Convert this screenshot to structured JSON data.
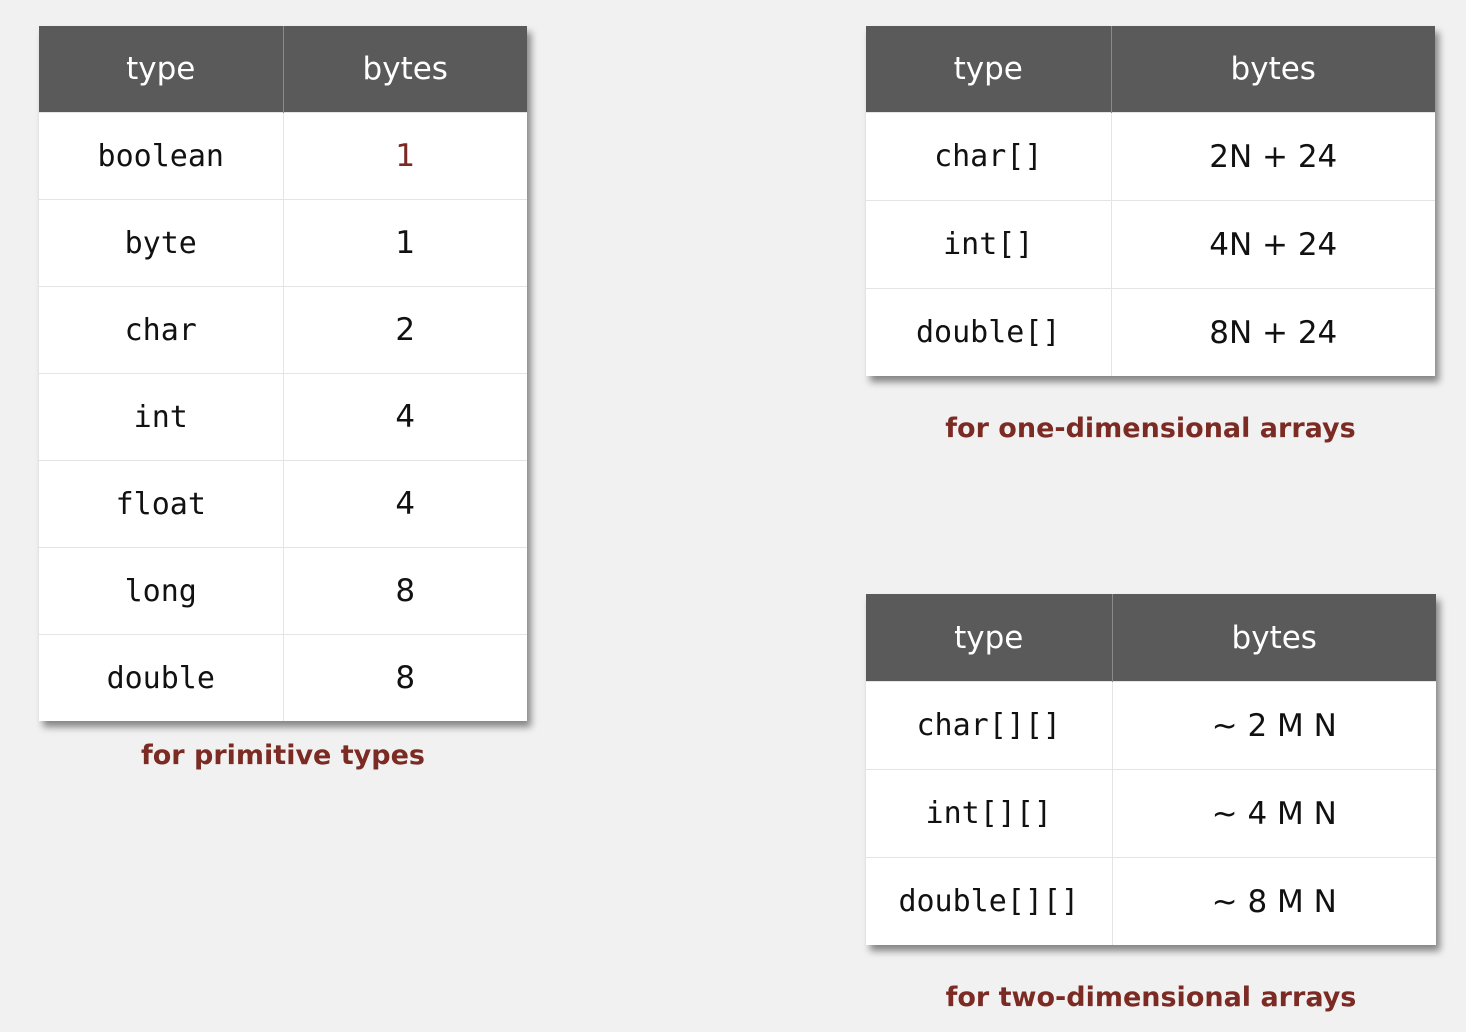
{
  "primitive": {
    "headers": [
      "type",
      "bytes"
    ],
    "rows": [
      {
        "type": "boolean",
        "bytes": "1"
      },
      {
        "type": "byte",
        "bytes": "1"
      },
      {
        "type": "char",
        "bytes": "2"
      },
      {
        "type": "int",
        "bytes": "4"
      },
      {
        "type": "float",
        "bytes": "4"
      },
      {
        "type": "long",
        "bytes": "8"
      },
      {
        "type": "double",
        "bytes": "8"
      }
    ],
    "caption": "for primitive types",
    "highlight_color": "#7a2a22"
  },
  "one_dim": {
    "headers": [
      "type",
      "bytes"
    ],
    "rows": [
      {
        "type": "char[]",
        "bytes": "2N + 24"
      },
      {
        "type": "int[]",
        "bytes": "4N + 24"
      },
      {
        "type": "double[]",
        "bytes": "8N + 24"
      }
    ],
    "caption": "for one-dimensional arrays"
  },
  "two_dim": {
    "headers": [
      "type",
      "bytes"
    ],
    "rows": [
      {
        "type": "char[][]",
        "bytes": "~ 2 M N"
      },
      {
        "type": "int[][]",
        "bytes": "~ 4 M N"
      },
      {
        "type": "double[][]",
        "bytes": "~ 8 M N"
      }
    ],
    "caption": "for two-dimensional arrays"
  },
  "colors": {
    "header_bg": "#5a5a5a",
    "caption": "#7b2b23",
    "background": "#f1f1f1"
  }
}
